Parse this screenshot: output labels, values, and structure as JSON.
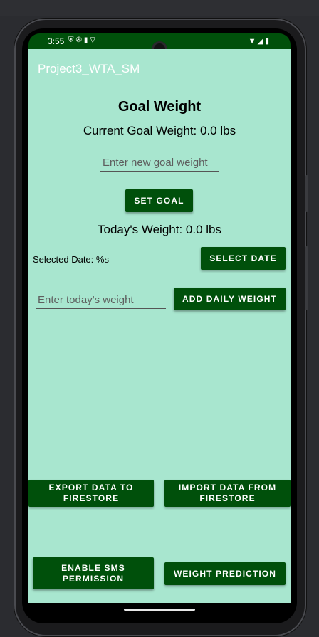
{
  "status_bar": {
    "time": "3:55",
    "left_icons": [
      "shield-icon",
      "fan-icon",
      "sd-card-icon",
      "vpn-icon"
    ],
    "right_icons": [
      "wifi-icon",
      "signal-icon",
      "battery-icon"
    ]
  },
  "app_bar": {
    "title": "Project3_WTA_SM",
    "background": "#a8e6cf"
  },
  "goal": {
    "title": "Goal Weight",
    "current_label": "Current Goal Weight: 0.0 lbs",
    "input_placeholder": "Enter new goal weight",
    "set_button": "SET GOAL"
  },
  "daily": {
    "today_label": "Today's Weight: 0.0 lbs",
    "selected_date": "Selected Date: %s",
    "select_date_button": "SELECT DATE",
    "input_placeholder": "Enter today's weight",
    "add_button": "ADD DAILY WEIGHT"
  },
  "actions": {
    "export_button": "EXPORT DATA TO FIRESTORE",
    "import_button": "IMPORT DATA FROM FIRESTORE",
    "sms_button": "ENABLE SMS PERMISSION",
    "prediction_button": "WEIGHT PREDICTION"
  },
  "colors": {
    "primary": "#00500b",
    "surface": "#a8e6cf"
  }
}
